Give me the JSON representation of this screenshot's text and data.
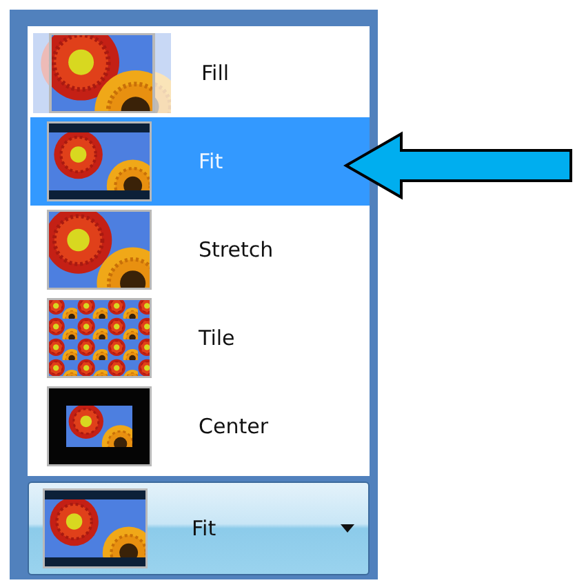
{
  "options": [
    {
      "label": "Fill",
      "kind": "fill",
      "selected": false
    },
    {
      "label": "Fit",
      "kind": "fit",
      "selected": true
    },
    {
      "label": "Stretch",
      "kind": "stretch",
      "selected": false
    },
    {
      "label": "Tile",
      "kind": "tile",
      "selected": false
    },
    {
      "label": "Center",
      "kind": "center",
      "selected": false
    }
  ],
  "combo": {
    "value": "Fit",
    "kind": "fit"
  }
}
